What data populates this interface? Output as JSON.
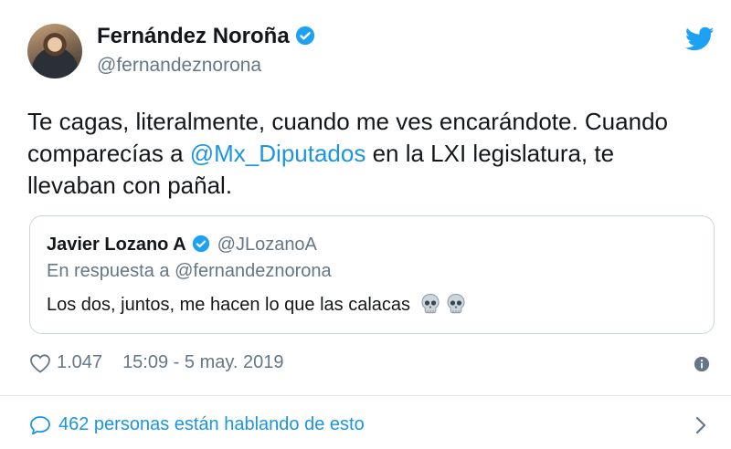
{
  "author": {
    "name": "Fernández Noroña",
    "handle": "@fernandeznorona"
  },
  "tweet": {
    "text_before": "Te cagas, literalmente, cuando me ves encarándote. Cuando comparecías a ",
    "mention": "@Mx_Diputados",
    "text_after": " en la LXI legislatura, te llevaban con pañal."
  },
  "quoted": {
    "name": "Javier Lozano A",
    "handle": "@JLozanoA",
    "reply_to": "En respuesta a @fernandeznorona",
    "text": "Los dos, juntos, me hacen lo que las calacas"
  },
  "footer": {
    "likes": "1.047",
    "timestamp": "15:09 - 5 may. 2019"
  },
  "conversation": {
    "label": "462 personas están hablando de esto"
  },
  "colors": {
    "brand": "#1da1f2",
    "link": "#1b95e0",
    "muted": "#657786"
  },
  "icons": [
    "verified-badge-icon",
    "twitter-bird-icon",
    "heart-icon",
    "info-icon",
    "speech-bubble-icon",
    "chevron-right-icon",
    "skull-icon"
  ]
}
